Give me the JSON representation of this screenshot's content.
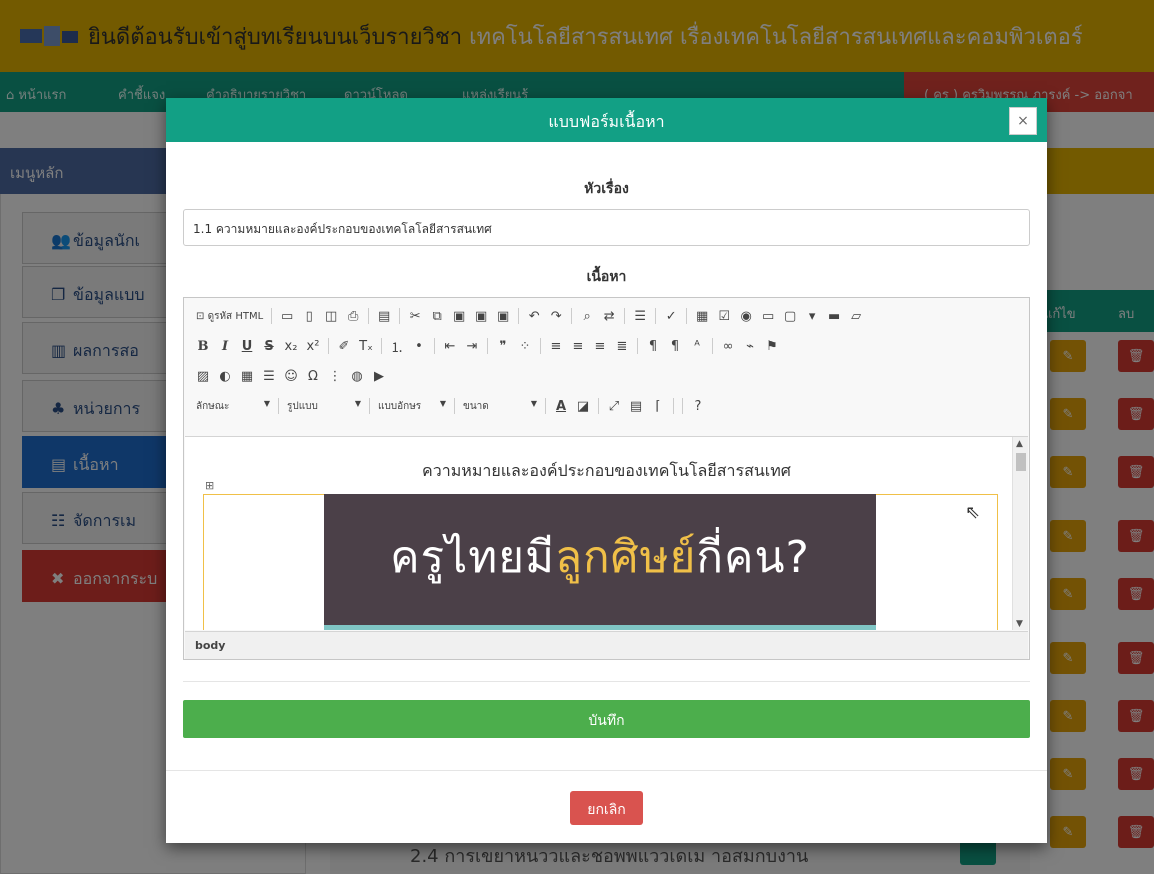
{
  "banner": {
    "welcome": "ยินดีต้อนรับเข้าสู่บทเรียนบนเว็บรายวิชา ",
    "subject": "เทคโนโลยีสารสนเทศ เรื่องเทคโนโลยีสารสนเทศและคอมพิวเตอร์"
  },
  "nav": {
    "home": "หน้าแรก",
    "guide": "คำชี้แจง",
    "description": "คำอธิบายรายวิชา",
    "download": "ดาวน์โหลด",
    "sources": "แหล่งเรียนรู้",
    "user_logout": "( ครู ) ครูวิมพรรณ ภารงค์ -> ออกจา"
  },
  "sidebar": {
    "heading": "เมนูหลัก",
    "items": [
      {
        "icon": "users-icon",
        "glyph": "👥",
        "label": "ข้อมูลนักเ"
      },
      {
        "icon": "copy-icon",
        "glyph": "❐",
        "label": "ข้อมูลแบบ"
      },
      {
        "icon": "bar-chart-icon",
        "glyph": "▥",
        "label": "ผลการสอ"
      },
      {
        "icon": "sitemap-icon",
        "glyph": "♣",
        "label": "หน่วยการ"
      },
      {
        "icon": "book-icon",
        "glyph": "▤",
        "label": "เนื้อหา"
      },
      {
        "icon": "menu-tree-icon",
        "glyph": "☷",
        "label": "จัดการเม"
      },
      {
        "icon": "close-icon",
        "glyph": "✖",
        "label": "ออกจากระบ"
      }
    ]
  },
  "table": {
    "edit_header": "แก้ไข",
    "delete_header": "ลบ",
    "edit_glyph": "✎",
    "delete_glyph": "🗑",
    "partial_row_text": "2.4 การเขยาหนววและชอพพแววเดเม าอสมกบงาน"
  },
  "modal": {
    "title": "แบบฟอร์มเนื้อหา",
    "close_glyph": "×",
    "topic_label": "หัวเรื่อง",
    "topic_value": "1.1 ความหมายและองค์ประกอบของเทคโลโลยีสารสนเทศ",
    "content_label": "เนื้อหา",
    "save_label": "บันทึก",
    "cancel_label": "ยกเลิก"
  },
  "editor": {
    "source_label": "ดูรหัส HTML",
    "style_combo": "ลักษณะ",
    "format_combo": "รูปแบบ",
    "font_combo": "แบบอักษร",
    "size_combo": "ขนาด",
    "help_glyph": "?",
    "body_heading": "ความหมายและองค์ประกอบของเทคโนโลยีสารสนเทศ",
    "image_text_a": "ครูไทยมี",
    "image_text_b": "ลูกศิษย์",
    "image_text_c": "กี่คน?",
    "path": "body"
  },
  "colors": {
    "banner": "#e6b400",
    "nav": "#12a085",
    "save": "#4cae4c",
    "cancel": "#d9534f"
  }
}
